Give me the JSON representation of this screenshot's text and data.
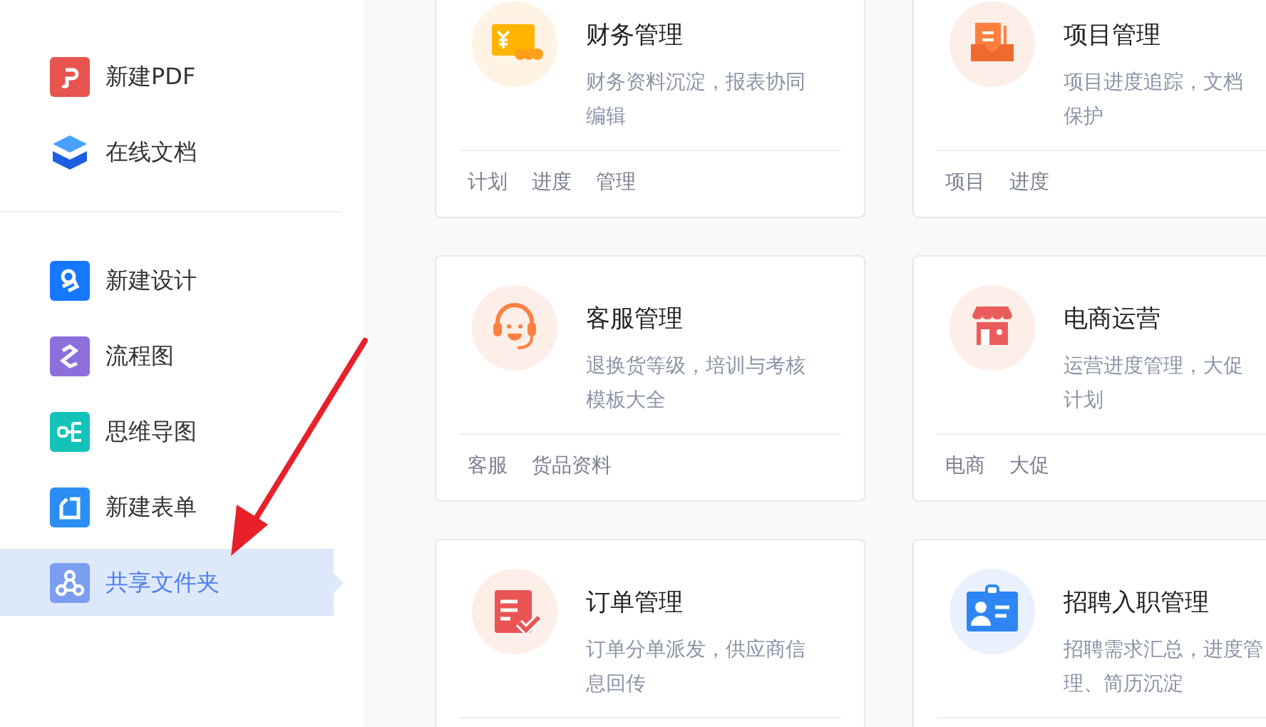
{
  "sidebar": {
    "groups": [
      [
        {
          "label": "新建PDF",
          "kind": "pdf",
          "selected": false
        },
        {
          "label": "在线文档",
          "kind": "doc",
          "selected": false
        }
      ],
      [
        {
          "label": "新建设计",
          "kind": "design",
          "selected": false
        },
        {
          "label": "流程图",
          "kind": "flow",
          "selected": false
        },
        {
          "label": "思维导图",
          "kind": "mind",
          "selected": false
        },
        {
          "label": "新建表单",
          "kind": "form",
          "selected": false
        },
        {
          "label": "共享文件夹",
          "kind": "share",
          "selected": true
        }
      ]
    ]
  },
  "cards": [
    {
      "title": "财务管理",
      "kind": "finance",
      "desc_lines": [
        "财务资料沉淀，报表协同",
        "编辑"
      ],
      "tags": [
        "计划",
        "进度",
        "管理"
      ]
    },
    {
      "title": "项目管理",
      "kind": "project",
      "desc_lines": [
        "项目进度追踪，文档",
        "保护"
      ],
      "tags": [
        "项目",
        "进度"
      ]
    },
    {
      "title": "客服管理",
      "kind": "service",
      "desc_lines": [
        "退换货等级，培训与考核",
        "模板大全"
      ],
      "tags": [
        "客服",
        "货品资料"
      ]
    },
    {
      "title": "电商运营",
      "kind": "shop",
      "desc_lines": [
        "运营进度管理，大促",
        "计划"
      ],
      "tags": [
        "电商",
        "大促"
      ]
    },
    {
      "title": "订单管理",
      "kind": "order",
      "desc_lines": [
        "订单分单派发，供应商信",
        "息回传"
      ]
    },
    {
      "title": "招聘入职管理",
      "kind": "hire",
      "desc_lines": [
        "招聘需求汇总，进度管",
        "理、简历沉淀"
      ]
    }
  ]
}
